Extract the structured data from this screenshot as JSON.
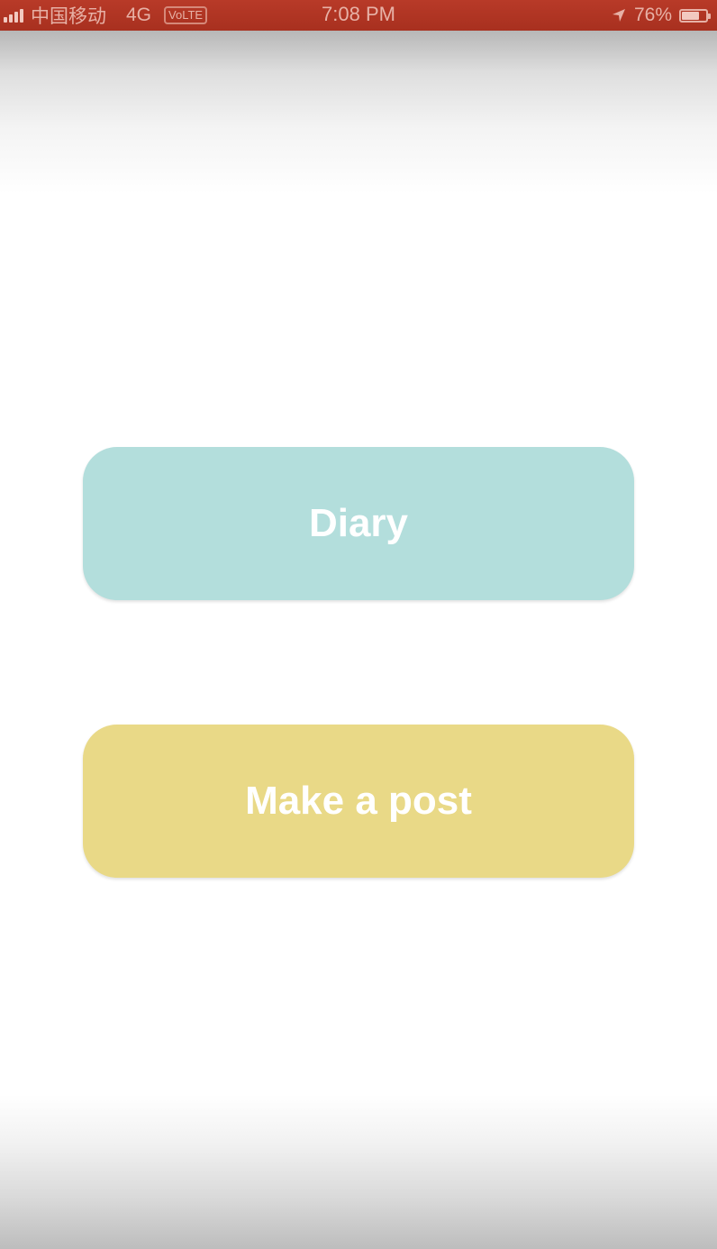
{
  "status_bar": {
    "carrier": "中国移动",
    "network": "4G",
    "volte": "VoLTE",
    "time": "7:08 PM",
    "battery_percent_text": "76%",
    "battery_level": 0.76,
    "signal_bars": 4,
    "icons": {
      "signal": "signal-bars-icon",
      "location": "location-arrow-icon",
      "battery": "battery-icon"
    },
    "background_color": "#b13625"
  },
  "main": {
    "diary_button": {
      "label": "Diary",
      "color": "#b3dedc"
    },
    "post_button": {
      "label": "Make a post",
      "color": "#e9d987"
    }
  }
}
